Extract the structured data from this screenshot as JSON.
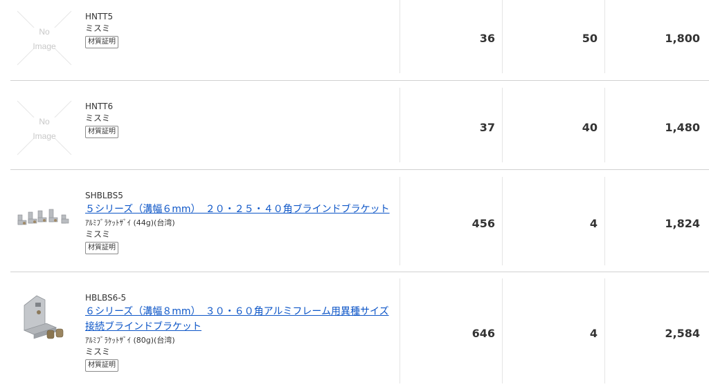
{
  "rows": [
    {
      "no_image_text_1": "No",
      "no_image_text_2": "Image",
      "code": "HNTT5",
      "maker": "ミスミ",
      "cert": "材質証明",
      "weight": "36",
      "qty": "50",
      "total": "1,800"
    },
    {
      "no_image_text_1": "No",
      "no_image_text_2": "Image",
      "code": "HNTT6",
      "maker": "ミスミ",
      "cert": "材質証明",
      "weight": "37",
      "qty": "40",
      "total": "1,480"
    },
    {
      "code": "SHBLBS5",
      "title": "５シリーズ（溝幅６mm）　２０・２５・４０角ブラインドブラケット",
      "spec": "ｱﾙﾐﾌﾞﾗｹｯﾄｻﾞｲ (44g)(台湾)",
      "maker": "ミスミ",
      "cert": "材質証明",
      "weight": "456",
      "qty": "4",
      "total": "1,824"
    },
    {
      "code": "HBLBS6-5",
      "title_line1": "６シリーズ（溝幅８mm）　３０・６０角アルミフレーム用異種サイズ",
      "title_line2": "接続ブラインドブラケット",
      "spec": "ｱﾙﾐﾌﾞﾗｹｯﾄｻﾞｲ (80g)(台湾)",
      "maker": "ミスミ",
      "cert": "材質証明",
      "weight": "646",
      "qty": "4",
      "total": "2,584"
    }
  ]
}
